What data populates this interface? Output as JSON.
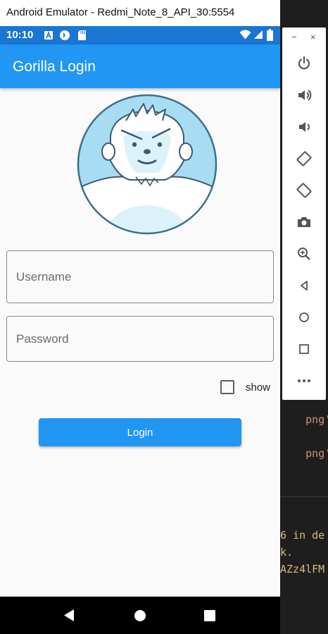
{
  "window": {
    "title": "Android Emulator - Redmi_Note_8_API_30:5554"
  },
  "status_bar": {
    "time": "10:10"
  },
  "app_bar": {
    "title": "Gorilla Login"
  },
  "form": {
    "username_placeholder": "Username",
    "password_placeholder": "Password",
    "show_label": "show",
    "login_label": "Login"
  },
  "emulator_toolbar": {
    "minimize": "−",
    "close": "×",
    "items": [
      "power-icon",
      "volume-up-icon",
      "volume-down-icon",
      "rotate-left-icon",
      "rotate-right-icon",
      "camera-icon",
      "zoom-icon",
      "back-icon",
      "home-icon",
      "overview-icon",
      "more-icon"
    ]
  },
  "code_editor": {
    "lines": [
      "png');",
      "png');",
      "6 in de",
      "k.",
      "AZz4lFM"
    ]
  },
  "colors": {
    "status_bar": "#1976d2",
    "primary": "#2196f3",
    "code_string": "#ce9178",
    "code_warning": "#d7ba7d"
  }
}
